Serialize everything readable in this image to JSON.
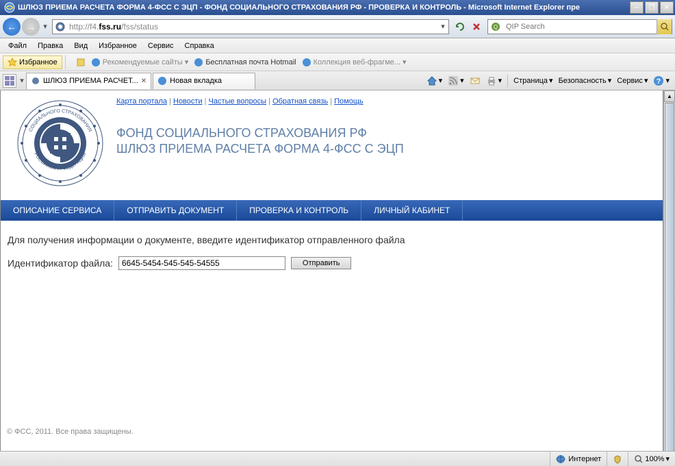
{
  "window": {
    "title": "ШЛЮЗ ПРИЕМА РАСЧЕТА ФОРМА 4-ФСС С ЭЦП - ФОНД СОЦИАЛЬНОГО СТРАХОВАНИЯ РФ - ПРОВЕРКА И КОНТРОЛЬ - Microsoft Internet Explorer пре"
  },
  "address": {
    "url_prefix": "http://f4.",
    "url_bold": "fss.ru",
    "url_suffix": "/fss/status"
  },
  "search": {
    "placeholder": "QIP Search"
  },
  "menu": {
    "file": "Файл",
    "edit": "Правка",
    "view": "Вид",
    "favorites": "Избранное",
    "tools": "Сервис",
    "help": "Справка"
  },
  "favbar": {
    "favorites_btn": "Избранное",
    "recommended": "Рекомендуемые сайты",
    "hotmail": "Бесплатная почта Hotmail",
    "webfrag": "Коллекция веб-фрагме..."
  },
  "tabs": {
    "tab1": "ШЛЮЗ ПРИЕМА РАСЧЕТ...",
    "tab2": "Новая вкладка"
  },
  "tools": {
    "page": "Страница",
    "safety": "Безопасность",
    "service": "Сервис"
  },
  "top_links": {
    "map": "Карта портала",
    "news": "Новости",
    "faq": "Частые вопросы",
    "feedback": "Обратная связь",
    "help": "Помощь"
  },
  "header": {
    "title": "ФОНД СОЦИАЛЬНОГО СТРАХОВАНИЯ РФ",
    "subtitle": "ШЛЮЗ ПРИЕМА РАСЧЕТА ФОРМА 4-ФСС С ЭЦП"
  },
  "navmenu": {
    "item1": "ОПИСАНИЕ СЕРВИСА",
    "item2": "ОТПРАВИТЬ ДОКУМЕНТ",
    "item3": "ПРОВЕРКА И КОНТРОЛЬ",
    "item4": "ЛИЧНЫЙ КАБИНЕТ"
  },
  "form": {
    "instruction": "Для получения информации о документе, введите идентификатор отправленного файла",
    "label": "Идентификатор файла:",
    "value": "6645-5454-545-545-54555",
    "submit": "Отправить"
  },
  "footer": "© ФСС, 2011. Все права защищены.",
  "status": {
    "zone": "Интернет",
    "zoom": "100%"
  }
}
